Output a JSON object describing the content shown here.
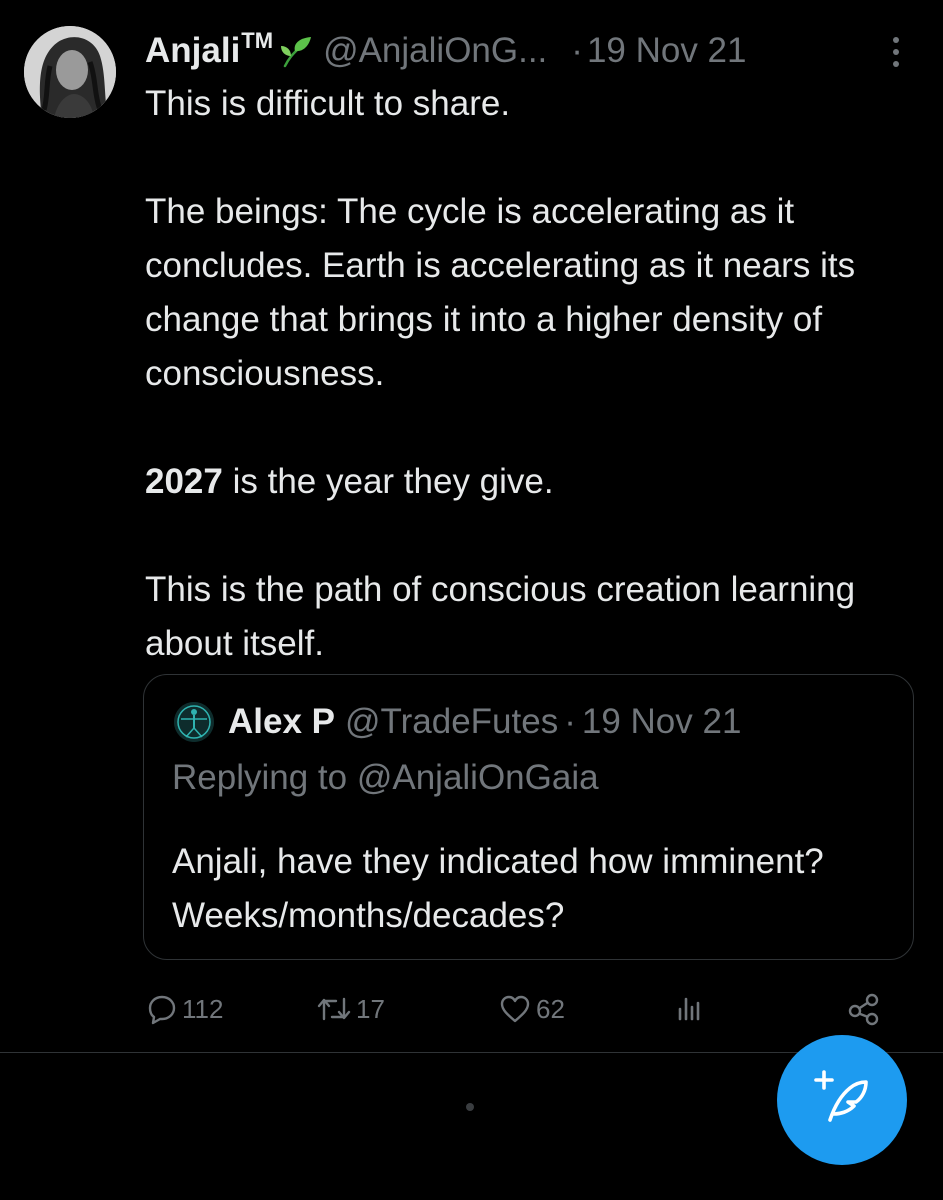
{
  "tweet": {
    "author_name": "Anjali",
    "author_tm": "TM",
    "author_emoji_icon": "seedling-icon",
    "handle": "@AnjaliOnG...",
    "separator": "·",
    "date": "19 Nov 21",
    "body": {
      "line1": "This is difficult to share.",
      "para2": "The beings: The cycle is accelerating as it concludes. Earth is accelerating as it nears its change that brings it into a higher density of consciousness.",
      "bold_year": "2027",
      "para3_rest": " is the year they give.",
      "para4": "This is the path of conscious creation learning about itself."
    }
  },
  "quoted_tweet": {
    "author_name": "Alex P",
    "handle": "@TradeFutes",
    "separator": "·",
    "date": "19 Nov 21",
    "replying_to": "Replying to @AnjaliOnGaia",
    "text": "Anjali, have they indicated how imminent? Weeks/months/decades?"
  },
  "actions": {
    "replies": "112",
    "retweets": "17",
    "likes": "62"
  },
  "colors": {
    "background": "#000000",
    "text": "#e7e9ea",
    "secondary": "#71767b",
    "border": "#2f3336",
    "accent": "#1d9bf0"
  }
}
